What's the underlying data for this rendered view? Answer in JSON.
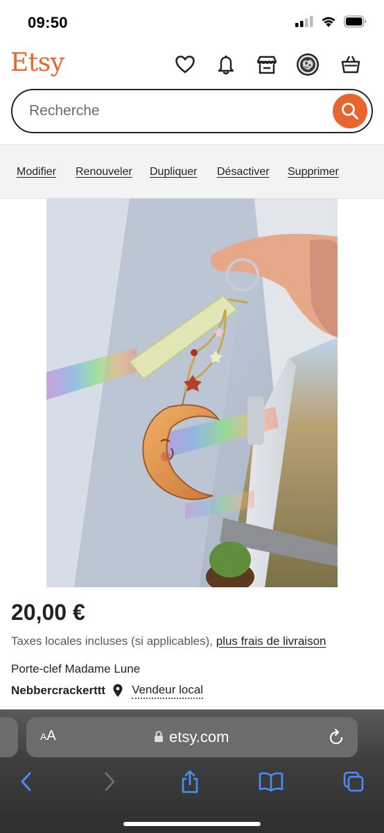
{
  "status": {
    "time": "09:50",
    "icons": [
      "signal-icon",
      "wifi-icon",
      "battery-icon"
    ]
  },
  "header": {
    "logo": "Etsy",
    "icons": [
      "heart-icon",
      "bell-icon",
      "shop-icon",
      "profile-avatar",
      "basket-icon"
    ],
    "accent": "#e8662d"
  },
  "search": {
    "placeholder": "Recherche"
  },
  "actions": {
    "edit": "Modifier",
    "renew": "Renouveler",
    "duplicate": "Dupliquer",
    "deactivate": "Désactiver",
    "delete": "Supprimer"
  },
  "product": {
    "price": "20,00 €",
    "tax_text": "Taxes locales incluses (si applicables), ",
    "shipping_link": "plus frais de livraison",
    "title": "Porte-clef Madame Lune",
    "seller": "Nebbercrackerttt",
    "local_seller": "Vendeur local"
  },
  "browser": {
    "aa_small": "A",
    "aa_large": "A",
    "url": "etsy.com",
    "toolbar_icons": [
      "back-icon",
      "forward-icon",
      "share-icon",
      "bookmarks-icon",
      "tabs-icon"
    ],
    "toolbar_color": "#4a8ff7"
  }
}
